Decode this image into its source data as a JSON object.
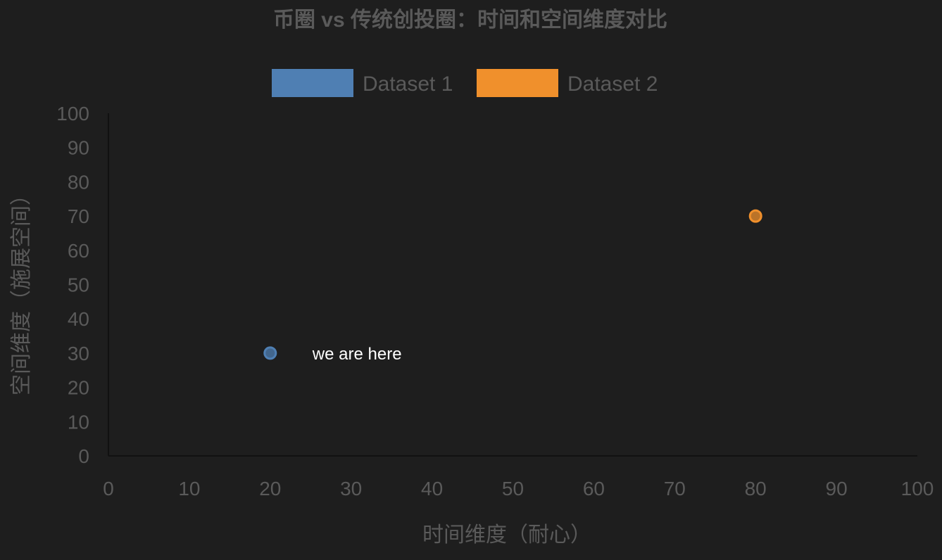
{
  "chart_data": {
    "type": "scatter",
    "title": "币圈 vs 传统创投圈：时间和空间维度对比",
    "xlabel": "时间维度（耐心）",
    "ylabel": "空间维度（施展空间）",
    "xlim": [
      0,
      100
    ],
    "ylim": [
      0,
      100
    ],
    "xticks": [
      "0",
      "10",
      "20",
      "30",
      "40",
      "50",
      "60",
      "70",
      "80",
      "90",
      "100"
    ],
    "yticks": [
      "0",
      "10",
      "20",
      "30",
      "40",
      "50",
      "60",
      "70",
      "80",
      "90",
      "100"
    ],
    "grid": false,
    "legend": "top",
    "series": [
      {
        "name": "Dataset 1",
        "color": "#4f7fb3",
        "points": [
          {
            "x": 20,
            "y": 30
          }
        ]
      },
      {
        "name": "Dataset 2",
        "color": "#f0902c",
        "points": [
          {
            "x": 80,
            "y": 70
          }
        ]
      }
    ],
    "annotations": [
      {
        "text": "we are here",
        "x": 20,
        "y": 30
      }
    ],
    "colors": {
      "background": "#1e1e1e",
      "text": "#5a5a5a",
      "annotation": "#ffffff"
    }
  }
}
